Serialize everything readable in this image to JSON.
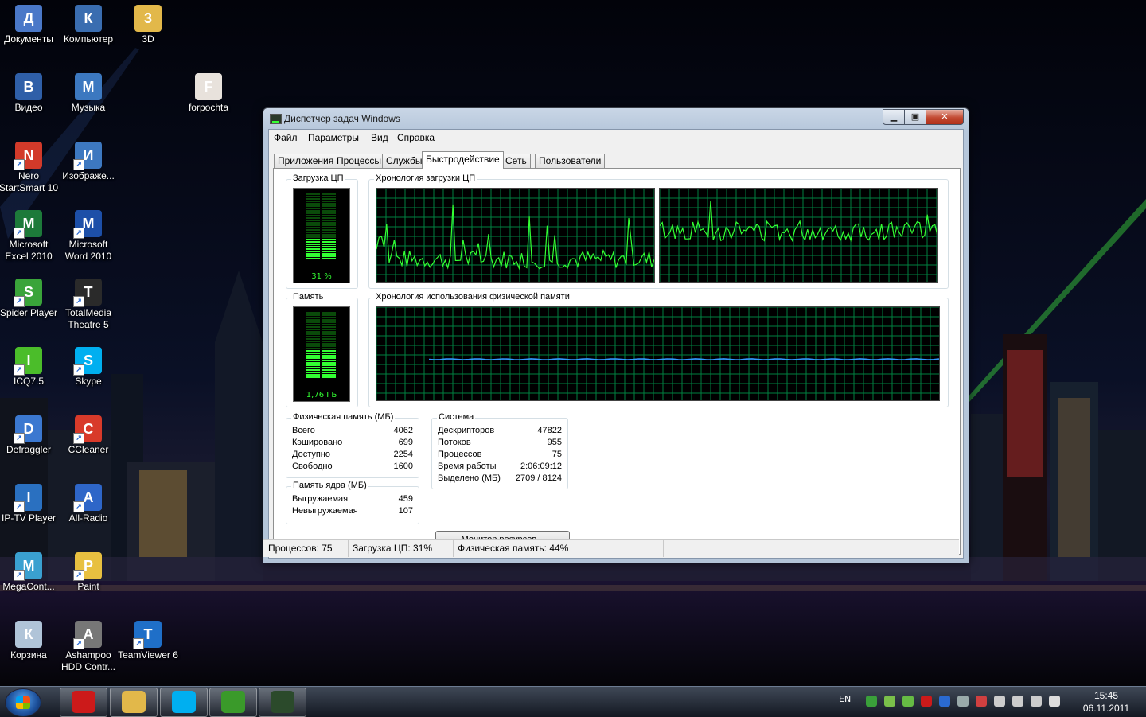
{
  "desktop_icons": [
    {
      "label": "Документы",
      "icon": "documents-icon",
      "color": "#4a78c8"
    },
    {
      "label": "Компьютер",
      "icon": "computer-icon",
      "color": "#3a6db0"
    },
    {
      "label": "3D",
      "icon": "folder-icon",
      "color": "#e2b84a"
    },
    {
      "label": "Видео",
      "icon": "video-icon",
      "color": "#2f5fa8"
    },
    {
      "label": "Музыка",
      "icon": "music-icon",
      "color": "#3c78c0"
    },
    {
      "label": "forpochta",
      "icon": "file-icon",
      "color": "#e8e2dc"
    },
    {
      "label": "Nero StartSmart 10",
      "icon": "nero-icon",
      "color": "#d23a2a"
    },
    {
      "label": "Изображе...",
      "icon": "pictures-icon",
      "color": "#3d78c0"
    },
    {
      "label": "Microsoft Excel 2010",
      "icon": "excel-icon",
      "color": "#1d7a3a"
    },
    {
      "label": "Microsoft Word 2010",
      "icon": "word-icon",
      "color": "#1d4fa8"
    },
    {
      "label": "Spider Player",
      "icon": "spider-player-icon",
      "color": "#3aa43a"
    },
    {
      "label": "TotalMedia Theatre 5",
      "icon": "totalmedia-icon",
      "color": "#2a2a2a"
    },
    {
      "label": "ICQ7.5",
      "icon": "icq-icon",
      "color": "#4bbd2a"
    },
    {
      "label": "Skype",
      "icon": "skype-icon",
      "color": "#00aff0"
    },
    {
      "label": "Defraggler",
      "icon": "defraggler-icon",
      "color": "#3b78d0"
    },
    {
      "label": "CCleaner",
      "icon": "ccleaner-icon",
      "color": "#d83a2a"
    },
    {
      "label": "IP-TV Player",
      "icon": "iptv-icon",
      "color": "#2a70c0"
    },
    {
      "label": "All-Radio",
      "icon": "all-radio-icon",
      "color": "#2e66c8"
    },
    {
      "label": "MegaCont...",
      "icon": "megacont-icon",
      "color": "#3aa0d0"
    },
    {
      "label": "Paint",
      "icon": "paint-icon",
      "color": "#e8c040"
    },
    {
      "label": "Корзина",
      "icon": "recycle-bin-icon",
      "color": "#b0c4d8"
    },
    {
      "label": "Ashampoo HDD Contr...",
      "icon": "ashampoo-icon",
      "color": "#777777"
    },
    {
      "label": "TeamViewer 6",
      "icon": "teamviewer-icon",
      "color": "#1f6fc8"
    }
  ],
  "window": {
    "title": "Диспетчер задач Windows",
    "menu": [
      "Файл",
      "Параметры",
      "Вид",
      "Справка"
    ],
    "tabs": [
      "Приложения",
      "Процессы",
      "Службы",
      "Быстродействие",
      "Сеть",
      "Пользователи"
    ],
    "active_tab": "Быстродействие",
    "cpu_label": "Загрузка ЦП",
    "cpu_value": "31 %",
    "cpu_fraction": 0.31,
    "cpu_history_label": "Хронология загрузки ЦП",
    "memory_label": "Память",
    "memory_value": "1,76 ГБ",
    "memory_fraction": 0.44,
    "memory_history_label": "Хронология использования физической памяти",
    "physical_memory": {
      "label": "Физическая память (МБ)",
      "rows": [
        {
          "key": "Всего",
          "value": "4062"
        },
        {
          "key": "Кэшировано",
          "value": "699"
        },
        {
          "key": "Доступно",
          "value": "2254"
        },
        {
          "key": "Свободно",
          "value": "1600"
        }
      ]
    },
    "kernel_memory": {
      "label": "Память ядра (МБ)",
      "rows": [
        {
          "key": "Выгружаемая",
          "value": "459"
        },
        {
          "key": "Невыгружаемая",
          "value": "107"
        }
      ]
    },
    "system": {
      "label": "Система",
      "rows": [
        {
          "key": "Дескрипторов",
          "value": "47822"
        },
        {
          "key": "Потоков",
          "value": "955"
        },
        {
          "key": "Процессов",
          "value": "75"
        },
        {
          "key": "Время работы",
          "value": "2:06:09:12"
        },
        {
          "key": "Выделено (МБ)",
          "value": "2709 / 8124"
        }
      ]
    },
    "resource_monitor_button": "Монитор ресурсов...",
    "status": {
      "processes": "Процессов: 75",
      "cpu": "Загрузка ЦП: 31%",
      "memory": "Физическая память: 44%"
    },
    "colors": {
      "graph_green": "#33ff33",
      "grid": "#008040",
      "memory_line": "#3399ff"
    }
  },
  "taskbar": {
    "pinned": [
      {
        "name": "opera-icon",
        "color": "#cc1a1a"
      },
      {
        "name": "explorer-icon",
        "color": "#e2b84a"
      },
      {
        "name": "skype-icon",
        "color": "#00aff0"
      },
      {
        "name": "utorrent-icon",
        "color": "#3a9a2a"
      },
      {
        "name": "task-manager-icon",
        "color": "#2b4a2b"
      }
    ],
    "language": "EN",
    "time": "15:45",
    "date": "06.11.2011"
  }
}
